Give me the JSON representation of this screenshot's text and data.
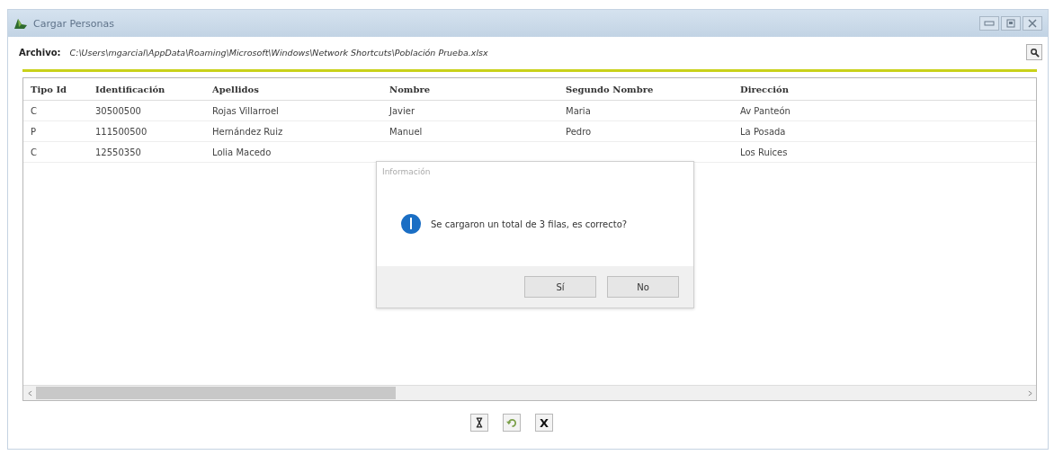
{
  "window": {
    "title": "Cargar Personas"
  },
  "file": {
    "label": "Archivo:",
    "path": "C:\\Users\\mgarcial\\AppData\\Roaming\\Microsoft\\Windows\\Network Shortcuts\\Población Prueba.xlsx"
  },
  "table": {
    "columns": [
      "Tipo Id",
      "Identificación",
      "Apellidos",
      "Nombre",
      "Segundo Nombre",
      "Dirección"
    ],
    "rows": [
      {
        "cells": [
          "C",
          "30500500",
          "Rojas Villarroel",
          "Javier",
          "Maria",
          "Av Panteón"
        ]
      },
      {
        "cells": [
          "P",
          "111500500",
          "Hernández Ruiz",
          "Manuel",
          "Pedro",
          "La Posada"
        ]
      },
      {
        "cells": [
          "C",
          "12550350",
          "Lolia Macedo",
          null,
          null,
          "Los Ruices"
        ]
      }
    ]
  },
  "dialog": {
    "title": "Información",
    "message": "Se cargaron un total de 3 filas, es correcto?",
    "buttons": [
      "Sí",
      "No"
    ]
  },
  "footer_buttons": [
    {
      "kind": "hourglass"
    },
    {
      "kind": "undo"
    },
    {
      "kind": "text",
      "label": "X"
    }
  ]
}
